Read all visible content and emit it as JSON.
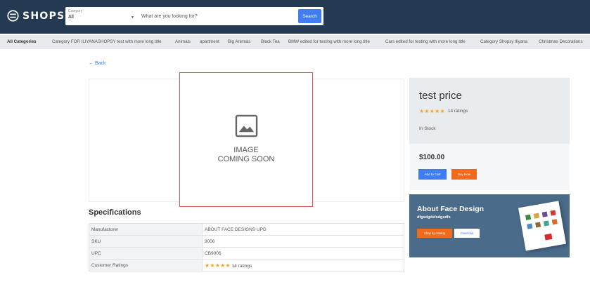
{
  "brand": {
    "name": "SHOPSY"
  },
  "search": {
    "category_label": "Category",
    "category_value": "All",
    "placeholder": "What are you looking for?",
    "button_label": "Search"
  },
  "categories": [
    "All Categories",
    "Category FOR ILIYANASHOPSY test with more long title",
    "Animals",
    "apartment",
    "Big Animals",
    "Black Tea",
    "BMW edited for testing with more long title",
    "Cars edited for testing with more long title",
    "Category Shopsy Iliyana",
    "Christmas Decorations"
  ],
  "nav": {
    "back_label": "← Back"
  },
  "product_image": {
    "text_line1": "IMAGE",
    "text_line2": "COMING SOON"
  },
  "product": {
    "title": "test price",
    "stars": "★★★★★",
    "rating_text": "14 ratings",
    "stock": "In Stock",
    "price": "$100.00",
    "add_to_cart_label": "Add to Cart",
    "buy_now_label": "Buy Now"
  },
  "specifications": {
    "title": "Specifications",
    "rows": [
      {
        "key": "Manufacturer",
        "value": "ABOUT FACE DESIGNS UPD"
      },
      {
        "key": "SKU",
        "value": "9006"
      },
      {
        "key": "UPC",
        "value": "CB9006"
      },
      {
        "key": "Customer Ratings",
        "stars": "★★★★★",
        "value": "14 ratings"
      }
    ]
  },
  "promo": {
    "title": "About Face Design",
    "subtitle": "dfgsdgdsfsdgsdfs",
    "shop_label": "Shop by catalog",
    "download_label": "Download"
  },
  "colors": {
    "header_bg": "#243a52",
    "accent_blue": "#3f7df0",
    "accent_orange": "#f26a1b",
    "star": "#f5a623",
    "promo_bg": "#4a6b8a"
  }
}
